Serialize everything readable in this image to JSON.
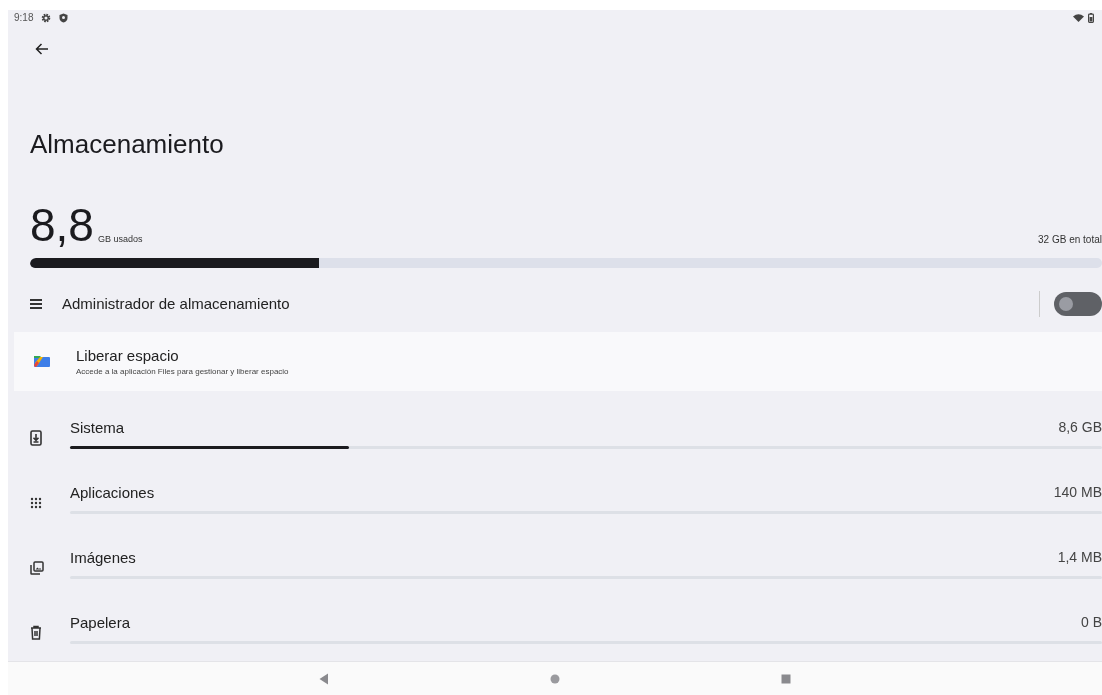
{
  "status_bar": {
    "time": "9:18"
  },
  "title": "Almacenamiento",
  "usage": {
    "used": "8,8",
    "used_unit": "GB usados",
    "total": "32 GB en total",
    "level": 0.27
  },
  "storage_manager": {
    "label": "Administrador de almacenamiento",
    "on": false
  },
  "free_up": {
    "title": "Liberar espacio",
    "subtitle": "Accede a la aplicación Files para gestionar y liberar espacio"
  },
  "categories": [
    {
      "kind": "system",
      "name": "Sistema",
      "size": "8,6 GB",
      "level": 0.27
    },
    {
      "kind": "apps",
      "name": "Aplicaciones",
      "size": "140 MB",
      "level": 0
    },
    {
      "kind": "images",
      "name": "Imágenes",
      "size": "1,4 MB",
      "level": 0
    },
    {
      "kind": "trash",
      "name": "Papelera",
      "size": "0 B",
      "level": 0
    }
  ]
}
